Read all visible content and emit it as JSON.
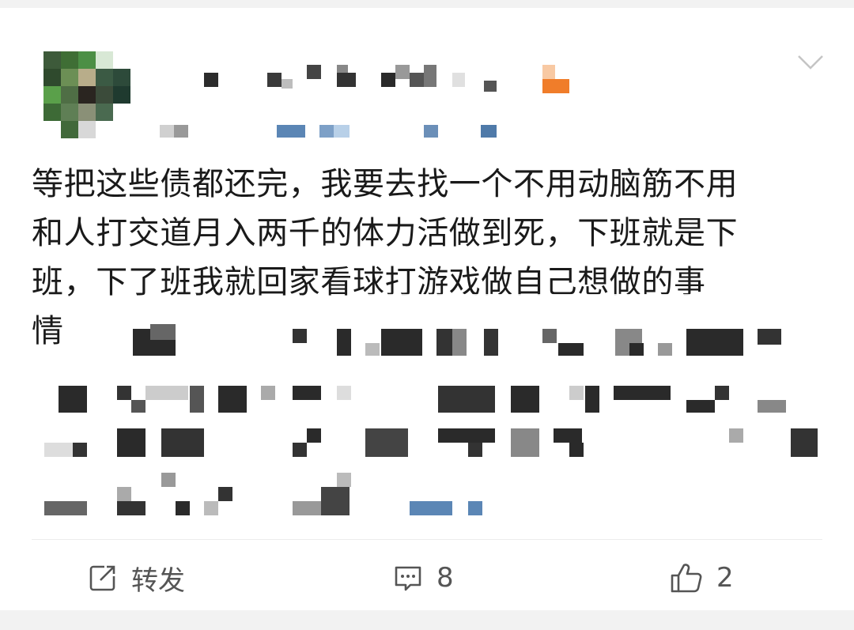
{
  "post": {
    "text_lines": [
      "等把这些债都还完，我要去找一个不用动脑筋不用",
      "和人打交道月入两千的体力活做到死，下班就是下",
      "班，下了班我就回家看球打游戏做自己想做的事",
      "情"
    ]
  },
  "actions": {
    "repost_label": "转发",
    "comment_count": "8",
    "like_count": "2"
  },
  "icons": {
    "menu": "chevron-down-icon",
    "repost": "share-arrow-icon",
    "comment": "comment-bubble-icon",
    "like": "thumbs-up-icon"
  },
  "colors": {
    "text": "#1a1a1a",
    "action_text": "#555555",
    "background": "#f2f2f2",
    "card": "#ffffff",
    "link_blue": "#5b86b5",
    "badge_orange": "#f07d2a"
  }
}
